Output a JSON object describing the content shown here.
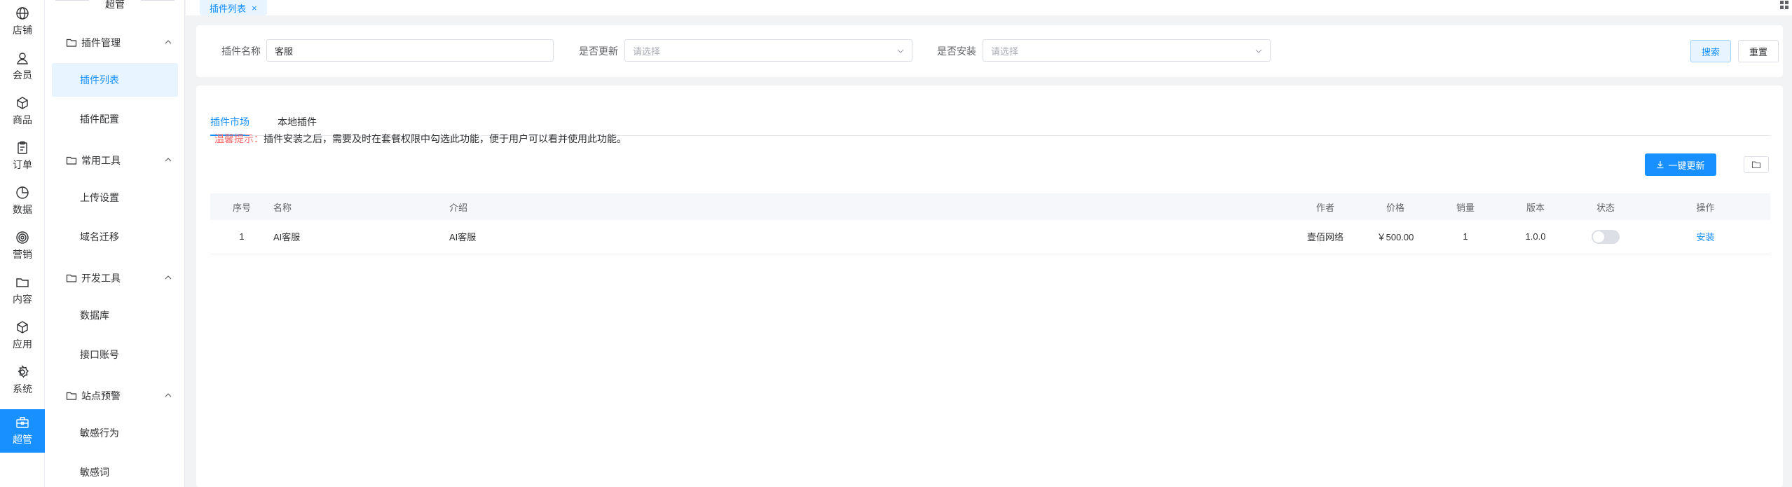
{
  "rail": [
    {
      "label": "店铺",
      "icon": "globe-icon"
    },
    {
      "label": "会员",
      "icon": "user-icon"
    },
    {
      "label": "商品",
      "icon": "box-icon"
    },
    {
      "label": "订单",
      "icon": "clipboard-icon"
    },
    {
      "label": "数据",
      "icon": "pie-chart-icon"
    },
    {
      "label": "营销",
      "icon": "target-icon"
    },
    {
      "label": "内容",
      "icon": "folder-icon"
    },
    {
      "label": "应用",
      "icon": "cube-icon"
    },
    {
      "label": "系统",
      "icon": "gear-icon"
    },
    {
      "label": "超管",
      "icon": "toolbox-icon",
      "active": true
    }
  ],
  "submenu": {
    "title": "超管",
    "groups": [
      {
        "label": "插件管理",
        "items": [
          "插件列表",
          "插件配置"
        ]
      },
      {
        "label": "常用工具",
        "items": [
          "上传设置",
          "域名迁移"
        ]
      },
      {
        "label": "开发工具",
        "items": [
          "数据库",
          "接口账号"
        ]
      },
      {
        "label": "站点预警",
        "items": [
          "敏感行为",
          "敏感词"
        ]
      }
    ]
  },
  "tabbar": {
    "active_tab": "插件列表",
    "close": "×"
  },
  "search": {
    "name_label": "插件名称",
    "name_value": "客服",
    "update_label": "是否更新",
    "update_placeholder": "请选择",
    "install_label": "是否安装",
    "install_placeholder": "请选择",
    "search_btn": "搜索",
    "reset_btn": "重置"
  },
  "main": {
    "tabs": [
      "插件市场",
      "本地插件"
    ],
    "tip_prefix": "温馨提示：",
    "tip_text": "插件安装之后，需要及时在套餐权限中勾选此功能，便于用户可以看并使用此功能。",
    "update_btn": "一键更新",
    "columns": [
      "序号",
      "名称",
      "介绍",
      "作者",
      "价格",
      "销量",
      "版本",
      "状态",
      "操作"
    ],
    "rows": [
      {
        "no": "1",
        "name": "AI客服",
        "intro": "AI客服",
        "author": "壹佰网络",
        "price": "￥500.00",
        "sales": "1",
        "version": "1.0.0",
        "status": false,
        "action": "安装"
      }
    ]
  },
  "colors": {
    "primary": "#1890ff",
    "warning": "#f56c6c"
  }
}
